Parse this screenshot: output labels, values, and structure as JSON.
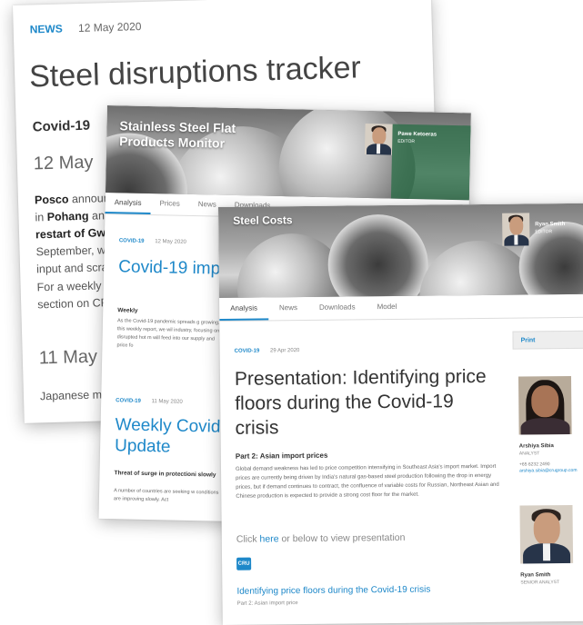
{
  "card1": {
    "tag": "NEWS",
    "date": "12 May 2020",
    "title": "Steel disruptions tracker",
    "subheading": "Covid-19",
    "section_date_1": "12 May",
    "para1_bold1": "Posco",
    "para1_text1": " announc",
    "para1_text2": "in ",
    "para1_bold2": "Pohang",
    "para1_text3": " and ",
    "para1_bold3": "restart of Gwan",
    "para1_text4": "September, whil",
    "para1_text5": "input and scrap",
    "para2_line1": "For a weekly imp",
    "para2_line2": "section on CRU",
    "section_date_2": "11 May",
    "para3": "Japanese major"
  },
  "card2": {
    "hero_title": "Stainless Steel Flat Products Monitor",
    "editor_name": "Pawe Ketoeras",
    "editor_role": "EDITOR",
    "tabs": [
      "Analysis",
      "Prices",
      "News",
      "Downloads"
    ],
    "article1": {
      "tag": "COVID-19",
      "date": "12 May 2020",
      "title": "Covid-19 imp supply — 12 N",
      "label": "Weekly",
      "body": "As the Covid-19 pandemic spreads g growing. In this weekly report, we wil industry, focusing on disrupted hot m will feed into our supply and price fo"
    },
    "article2": {
      "tag": "COVID-19",
      "date": "11 May 2020",
      "title": "Weekly Covid Update",
      "heading": "Threat of surge in protectioni slowly",
      "body": "A number of countries are seeking w conditions are improving slowly. Act"
    }
  },
  "card3": {
    "hero_title": "Steel Costs",
    "editor_name": "Ryan Smith",
    "editor_role": "EDITOR",
    "tabs": [
      "Analysis",
      "News",
      "Downloads",
      "Model"
    ],
    "tag": "COVID-19",
    "date": "29 Apr 2020",
    "title": "Presentation: Identifying price floors during the Covid-19 crisis",
    "part": "Part 2: Asian import prices",
    "body": "Global demand weakness has led to price competition intensifying in Southeast Asia's import market. Import prices are currently being driven by India's natural gas-based steel production following the drop in energy prices, but if demand continues to contract, the confluence of variable costs for Russian, Northeast Asian and Chinese production is expected to provide a strong cost floor for the market.",
    "click_prefix": "Click ",
    "click_link": "here",
    "click_suffix": " or below to view presentation",
    "logo_text": "CRU",
    "download_title": "Identifying price floors during the Covid-19 crisis",
    "download_sub": "Part 2: Asian import price",
    "sidebar": {
      "print_label": "Print",
      "analyst1_name": "Arshiya Sibia",
      "analyst1_role": "ANALYST",
      "analyst1_phone": "+65 6232 2490",
      "analyst1_email": "arshiya.sibia@crugroup.com",
      "analyst2_name": "Ryan Smith",
      "analyst2_role": "SENIOR ANALYST"
    }
  },
  "colors": {
    "accent": "#1e88c9"
  }
}
